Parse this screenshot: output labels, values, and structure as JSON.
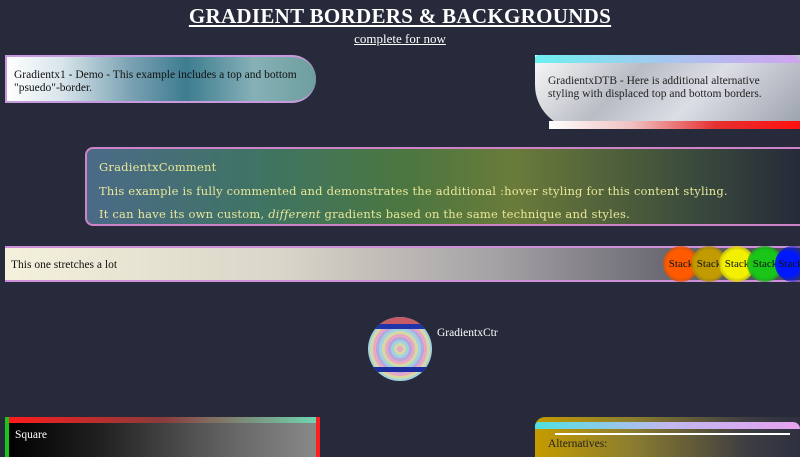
{
  "header": {
    "title": "GRADIENT BORDERS & BACKGROUNDS",
    "subtitle": "complete for now"
  },
  "cards": {
    "gradientx1": "Gradientx1 - Demo - This example includes a top and bottom \"psuedo\"-border.",
    "gradientxdtb": "GradientxDTB - Here is additional alternative styling with displaced top and bottom borders."
  },
  "comment": {
    "title": "GradientxComment",
    "line1": "This example is fully commented and demonstrates the additional :hover styling for this content styling.",
    "line2_before": "It can have its own custom, ",
    "line2_emphasis": "different",
    "line2_after": " gradients based on the same technique and styles."
  },
  "stretch": {
    "label": "This one stretches a lot",
    "stack_label": "Stack",
    "stack_colors": [
      "#ff5a00",
      "#c29b00",
      "#f2f000",
      "#18c518",
      "#0018ff"
    ]
  },
  "center": {
    "label": "GradientxCtr"
  },
  "square": {
    "label": "Square"
  },
  "alternatives": {
    "label": "Alternatives:"
  }
}
